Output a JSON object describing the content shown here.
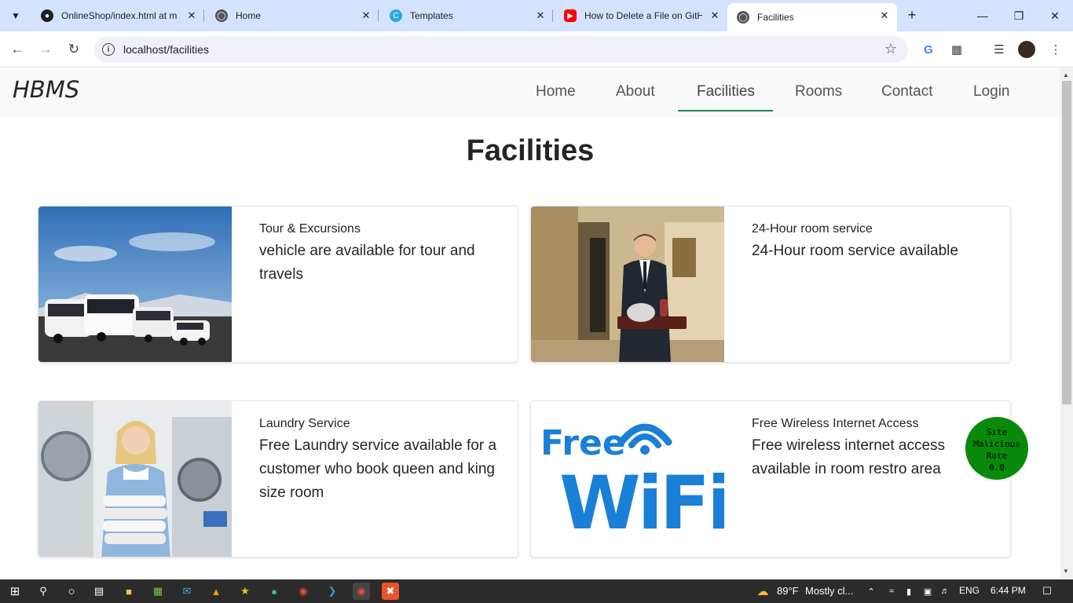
{
  "browser": {
    "tabs": [
      {
        "title": "OnlineShop/index.html at m",
        "favicon": "github-icon",
        "active": false
      },
      {
        "title": "Home",
        "favicon": "globe-icon",
        "active": false
      },
      {
        "title": "Templates",
        "favicon": "canva-icon",
        "active": false
      },
      {
        "title": "How to Delete a File on GitH",
        "favicon": "youtube-icon",
        "active": false
      },
      {
        "title": "Facilities",
        "favicon": "globe-icon",
        "active": true
      }
    ],
    "url": "localhost/facilities"
  },
  "site": {
    "brand": "HBMS",
    "nav": [
      {
        "label": "Home"
      },
      {
        "label": "About"
      },
      {
        "label": "Facilities",
        "active": true
      },
      {
        "label": "Rooms"
      },
      {
        "label": "Contact"
      },
      {
        "label": "Login"
      }
    ],
    "accent_color": "#198754"
  },
  "page": {
    "title": "Facilities",
    "cards": [
      {
        "title": "Tour & Excursions",
        "text": "vehicle are available for tour and travels",
        "image": "buses-photo"
      },
      {
        "title": "24-Hour room service",
        "text": "24-Hour room service available",
        "image": "room-service-photo"
      },
      {
        "title": "Laundry Service",
        "text": "Free Laundry service available for a customer who book queen and king size room",
        "image": "laundry-photo"
      },
      {
        "title": "Free Wireless Internet Access",
        "text": "Free wireless internet access available in room restro area",
        "image": "free-wifi-logo"
      }
    ],
    "wifi_logo": {
      "line1": "Free",
      "line2": "WiFi"
    }
  },
  "badge": {
    "line1": "Site",
    "line2": "Malicious",
    "line3": "Rate",
    "line4": "0.0"
  },
  "taskbar": {
    "weather_temp": "89°F",
    "weather_text": "Mostly cl...",
    "language": "ENG",
    "time": "6:44 PM"
  }
}
